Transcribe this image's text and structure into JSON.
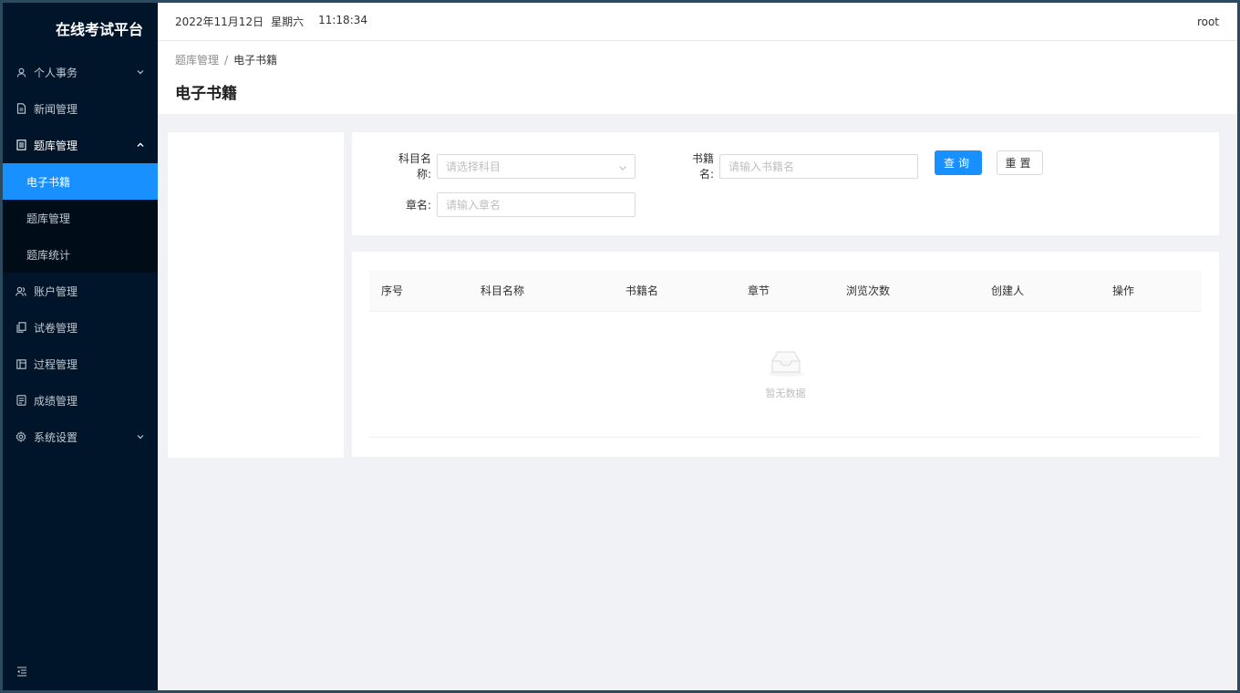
{
  "app": {
    "title": "在线考试平台"
  },
  "sidebar": {
    "items": [
      {
        "label": "个人事务",
        "icon": "user-icon",
        "has_arrow": true,
        "arrow": "down"
      },
      {
        "label": "新闻管理",
        "icon": "document-icon"
      },
      {
        "label": "题库管理",
        "icon": "list-icon",
        "has_arrow": true,
        "arrow": "up",
        "open": true,
        "children": [
          {
            "label": "电子书籍",
            "active": true
          },
          {
            "label": "题库管理"
          },
          {
            "label": "题库统计"
          }
        ]
      },
      {
        "label": "账户管理",
        "icon": "users-icon"
      },
      {
        "label": "试卷管理",
        "icon": "copy-icon"
      },
      {
        "label": "过程管理",
        "icon": "layout-icon"
      },
      {
        "label": "成绩管理",
        "icon": "report-icon"
      },
      {
        "label": "系统设置",
        "icon": "gear-icon",
        "has_arrow": true,
        "arrow": "down"
      }
    ],
    "collapse_icon": "collapse-menu-icon"
  },
  "topbar": {
    "date": "2022年11月12日",
    "weekday": "星期六",
    "time": "11:18:34",
    "user": "root"
  },
  "page": {
    "breadcrumb": {
      "parent": "题库管理",
      "separator": "/",
      "current": "电子书籍"
    },
    "title": "电子书籍"
  },
  "search": {
    "subject_label": "科目名称:",
    "subject_placeholder": "请选择科目",
    "book_label": "书籍名:",
    "book_placeholder": "请输入书籍名",
    "chapter_label": "章名:",
    "chapter_placeholder": "请输入章名",
    "query_button": "查询",
    "reset_button": "重置"
  },
  "table": {
    "columns": [
      "序号",
      "科目名称",
      "书籍名",
      "章节",
      "浏览次数",
      "创建人",
      "操作"
    ],
    "rows": [],
    "empty_text": "暂无数据"
  },
  "colors": {
    "sidebar_bg": "#001529",
    "accent": "#1890ff",
    "page_bg": "#f0f2f5"
  }
}
